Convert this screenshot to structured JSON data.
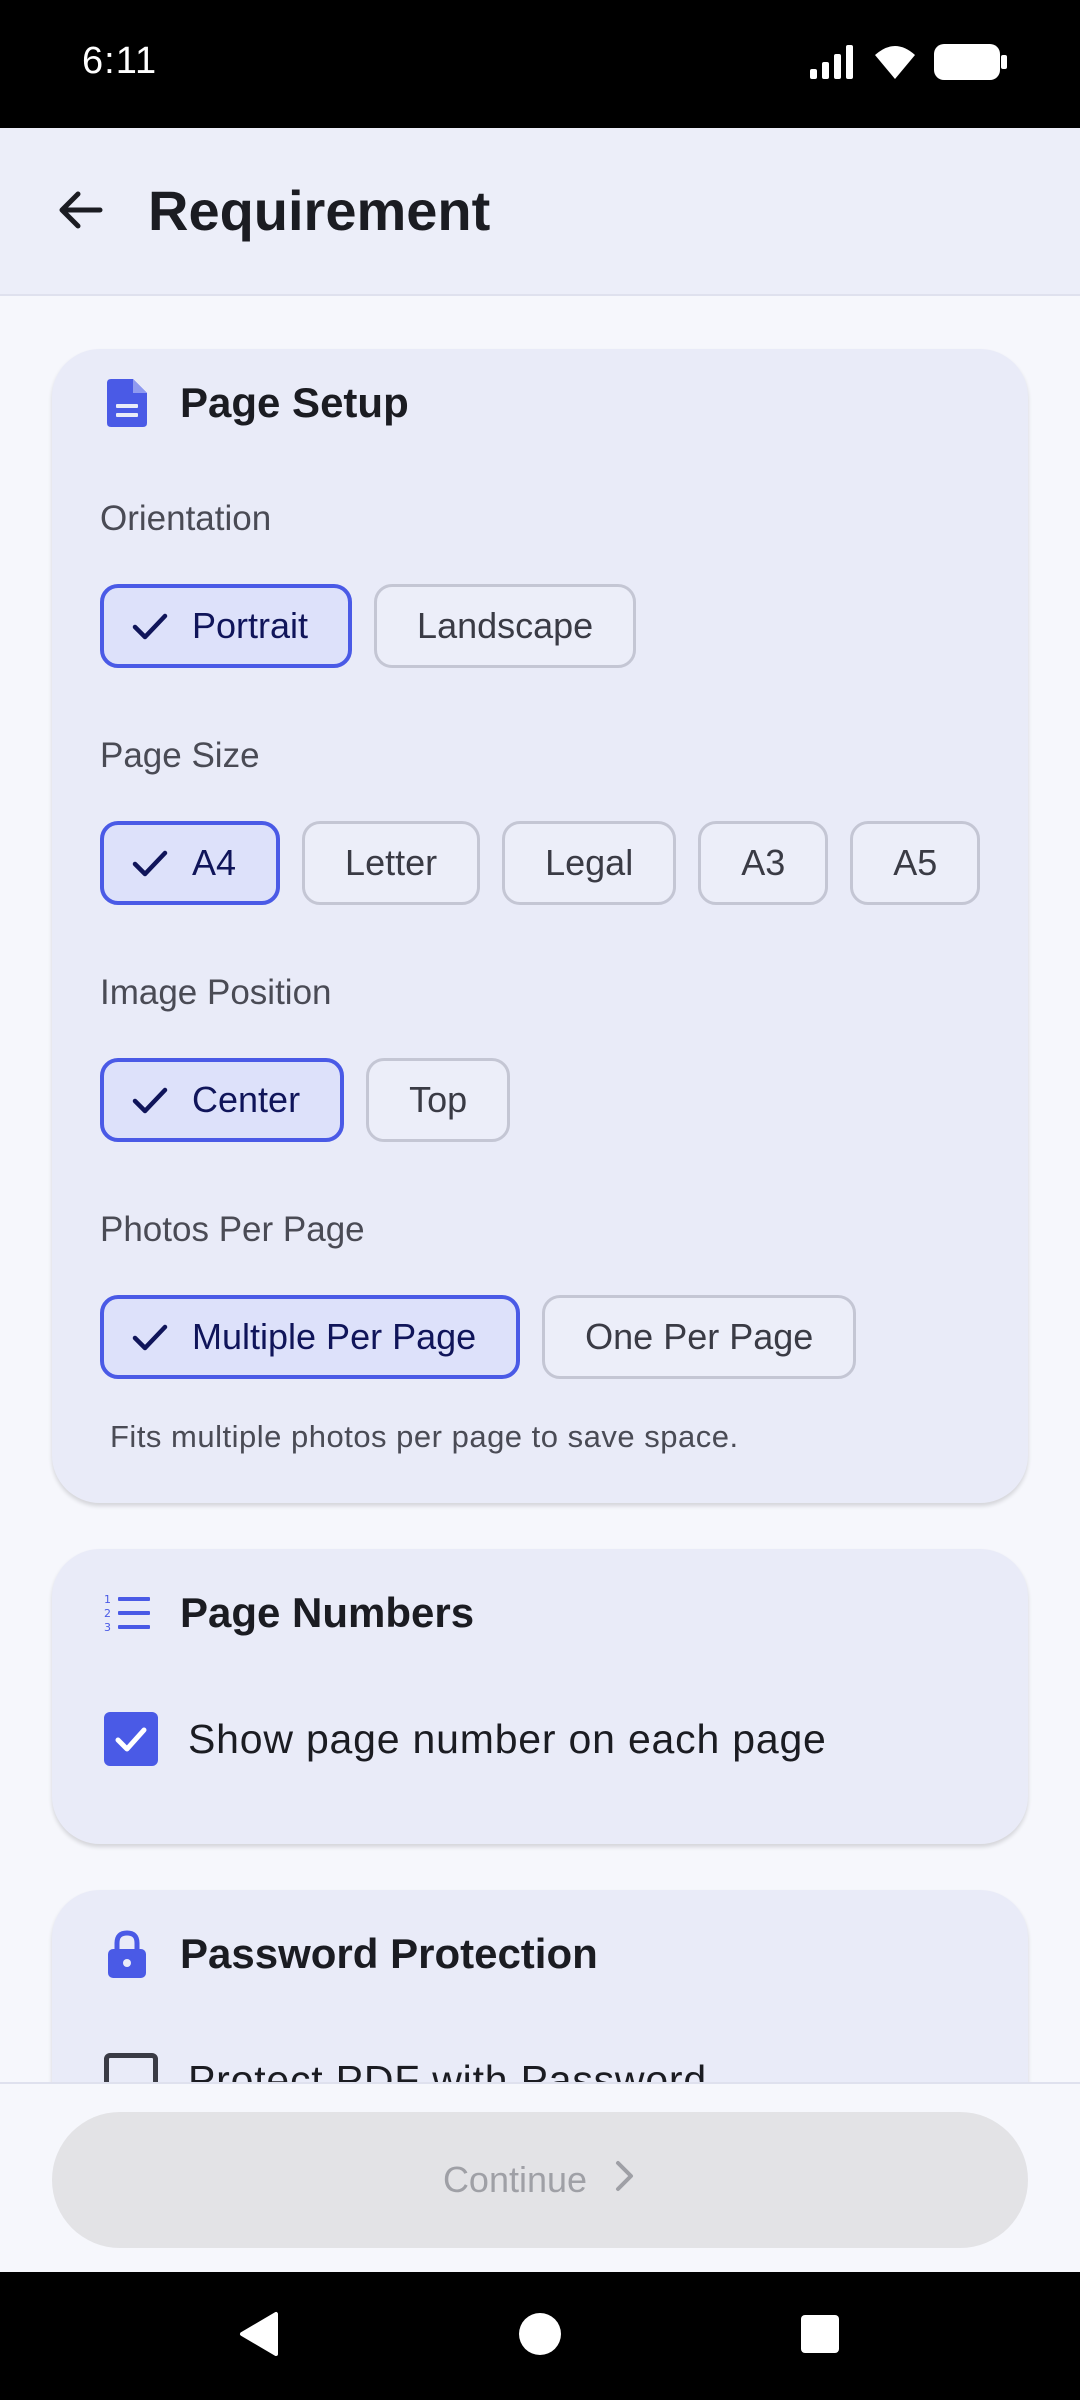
{
  "status_bar": {
    "time": "6:11",
    "icons": [
      "signal-icon",
      "wifi-icon",
      "battery-icon"
    ]
  },
  "app_bar": {
    "title": "Requirement",
    "back_icon": "arrow-left-icon"
  },
  "page_setup": {
    "title": "Page Setup",
    "icon": "document-icon",
    "orientation": {
      "label": "Orientation",
      "options": [
        "Portrait",
        "Landscape"
      ],
      "selected": "Portrait"
    },
    "page_size": {
      "label": "Page Size",
      "options": [
        "A4",
        "Letter",
        "Legal",
        "A3",
        "A5"
      ],
      "selected": "A4"
    },
    "image_position": {
      "label": "Image Position",
      "options": [
        "Center",
        "Top"
      ],
      "selected": "Center"
    },
    "photos_per_page": {
      "label": "Photos Per Page",
      "options": [
        "Multiple Per Page",
        "One Per Page"
      ],
      "selected": "Multiple Per Page"
    },
    "hint": "Fits multiple photos per page to save space."
  },
  "page_numbers": {
    "title": "Page Numbers",
    "icon": "numbered-list-icon",
    "checkbox_label": "Show page number on each page",
    "checked": true
  },
  "password_protection": {
    "title": "Password Protection",
    "icon": "lock-icon",
    "checkbox_label": "Protect PDF with Password",
    "checked": false
  },
  "footer": {
    "continue_label": "Continue",
    "continue_enabled": false
  },
  "colors": {
    "accent": "#4a5ae6",
    "card_bg": "#e9ebf8",
    "selected_chip_bg": "#dde1fa",
    "disabled_button": "#e3e3e6"
  }
}
